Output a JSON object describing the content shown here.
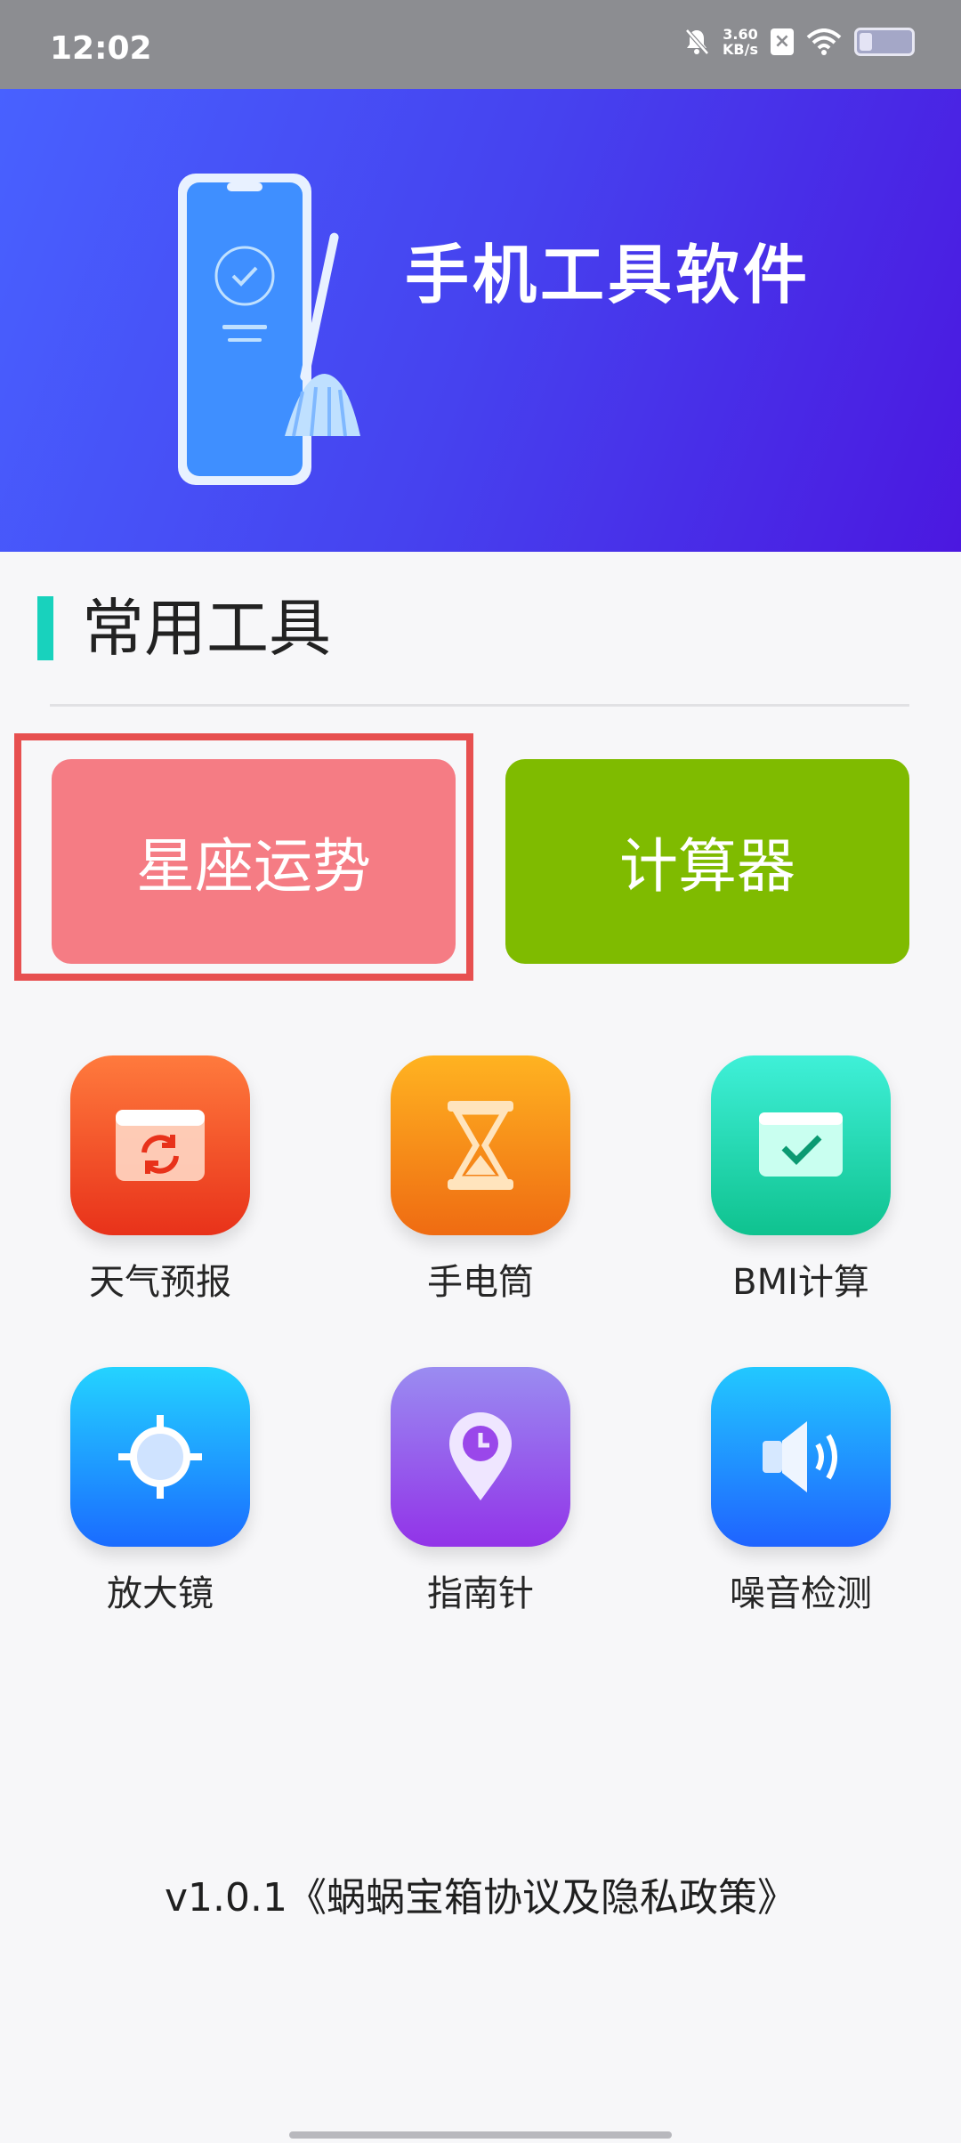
{
  "status_bar": {
    "time": "12:02",
    "speed_value": "3.60",
    "speed_unit": "KB/s"
  },
  "banner": {
    "title": "手机工具软件"
  },
  "section": {
    "title": "常用工具"
  },
  "buttons": {
    "xingzuo": "星座运势",
    "calculator": "计算器"
  },
  "tools": {
    "weather": {
      "label": "天气预报",
      "icon": "calendar-refresh-icon"
    },
    "flashlight": {
      "label": "手电筒",
      "icon": "hourglass-icon"
    },
    "bmi": {
      "label": "BMI计算",
      "icon": "monitor-check-icon"
    },
    "magnifier": {
      "label": "放大镜",
      "icon": "crosshair-icon"
    },
    "compass": {
      "label": "指南针",
      "icon": "location-clock-icon"
    },
    "noise": {
      "label": "噪音检测",
      "icon": "speaker-icon"
    }
  },
  "footer": {
    "text": "v1.0.1《蜗蜗宝箱协议及隐私政策》"
  },
  "colors": {
    "banner_start": "#4861ff",
    "banner_end": "#4b18e0",
    "accent": "#18d2bd",
    "xingzuo_button": "#f57c84",
    "calculator_button": "#7fbb00",
    "highlight_border": "#e75050"
  }
}
